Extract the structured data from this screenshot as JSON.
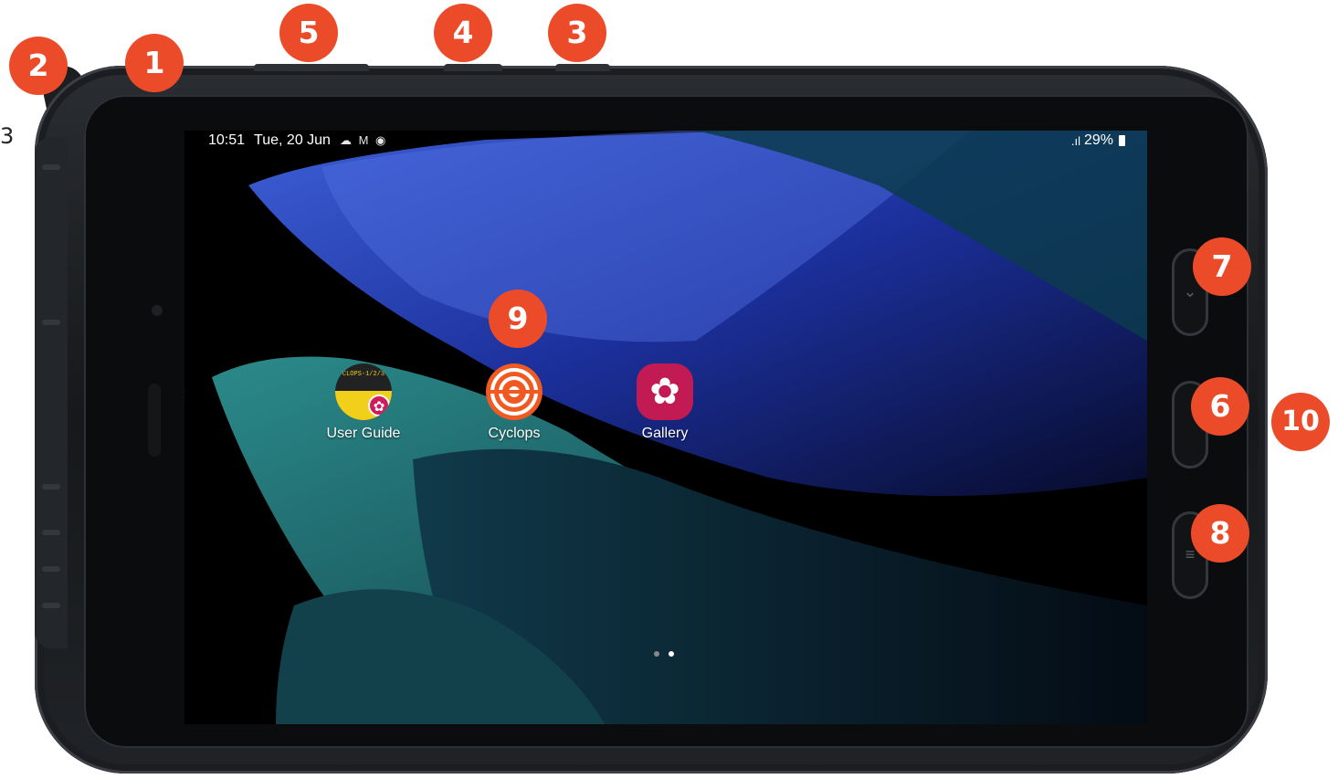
{
  "status_bar": {
    "time": "10:51",
    "date": "Tue, 20 Jun",
    "notification_icons": "☁ M ◉",
    "signal": ".ıl",
    "battery": "29%"
  },
  "apps": [
    {
      "label": "User Guide",
      "icon": "book-guide-icon",
      "cover_text": "CLOPS-1/2/3"
    },
    {
      "label": "Cyclops",
      "icon": "cyclops-target-icon"
    },
    {
      "label": "Gallery",
      "icon": "flower-icon"
    }
  ],
  "callouts": [
    "1",
    "2",
    "3",
    "4",
    "5",
    "6",
    "7",
    "8",
    "9",
    "10"
  ],
  "edge_fragment": "3",
  "colors": {
    "callout": "#ec4b2a",
    "cyclops": "#f05a22",
    "gallery": "#c21a52"
  },
  "page_indicator": {
    "pages": 2,
    "active": 2
  }
}
